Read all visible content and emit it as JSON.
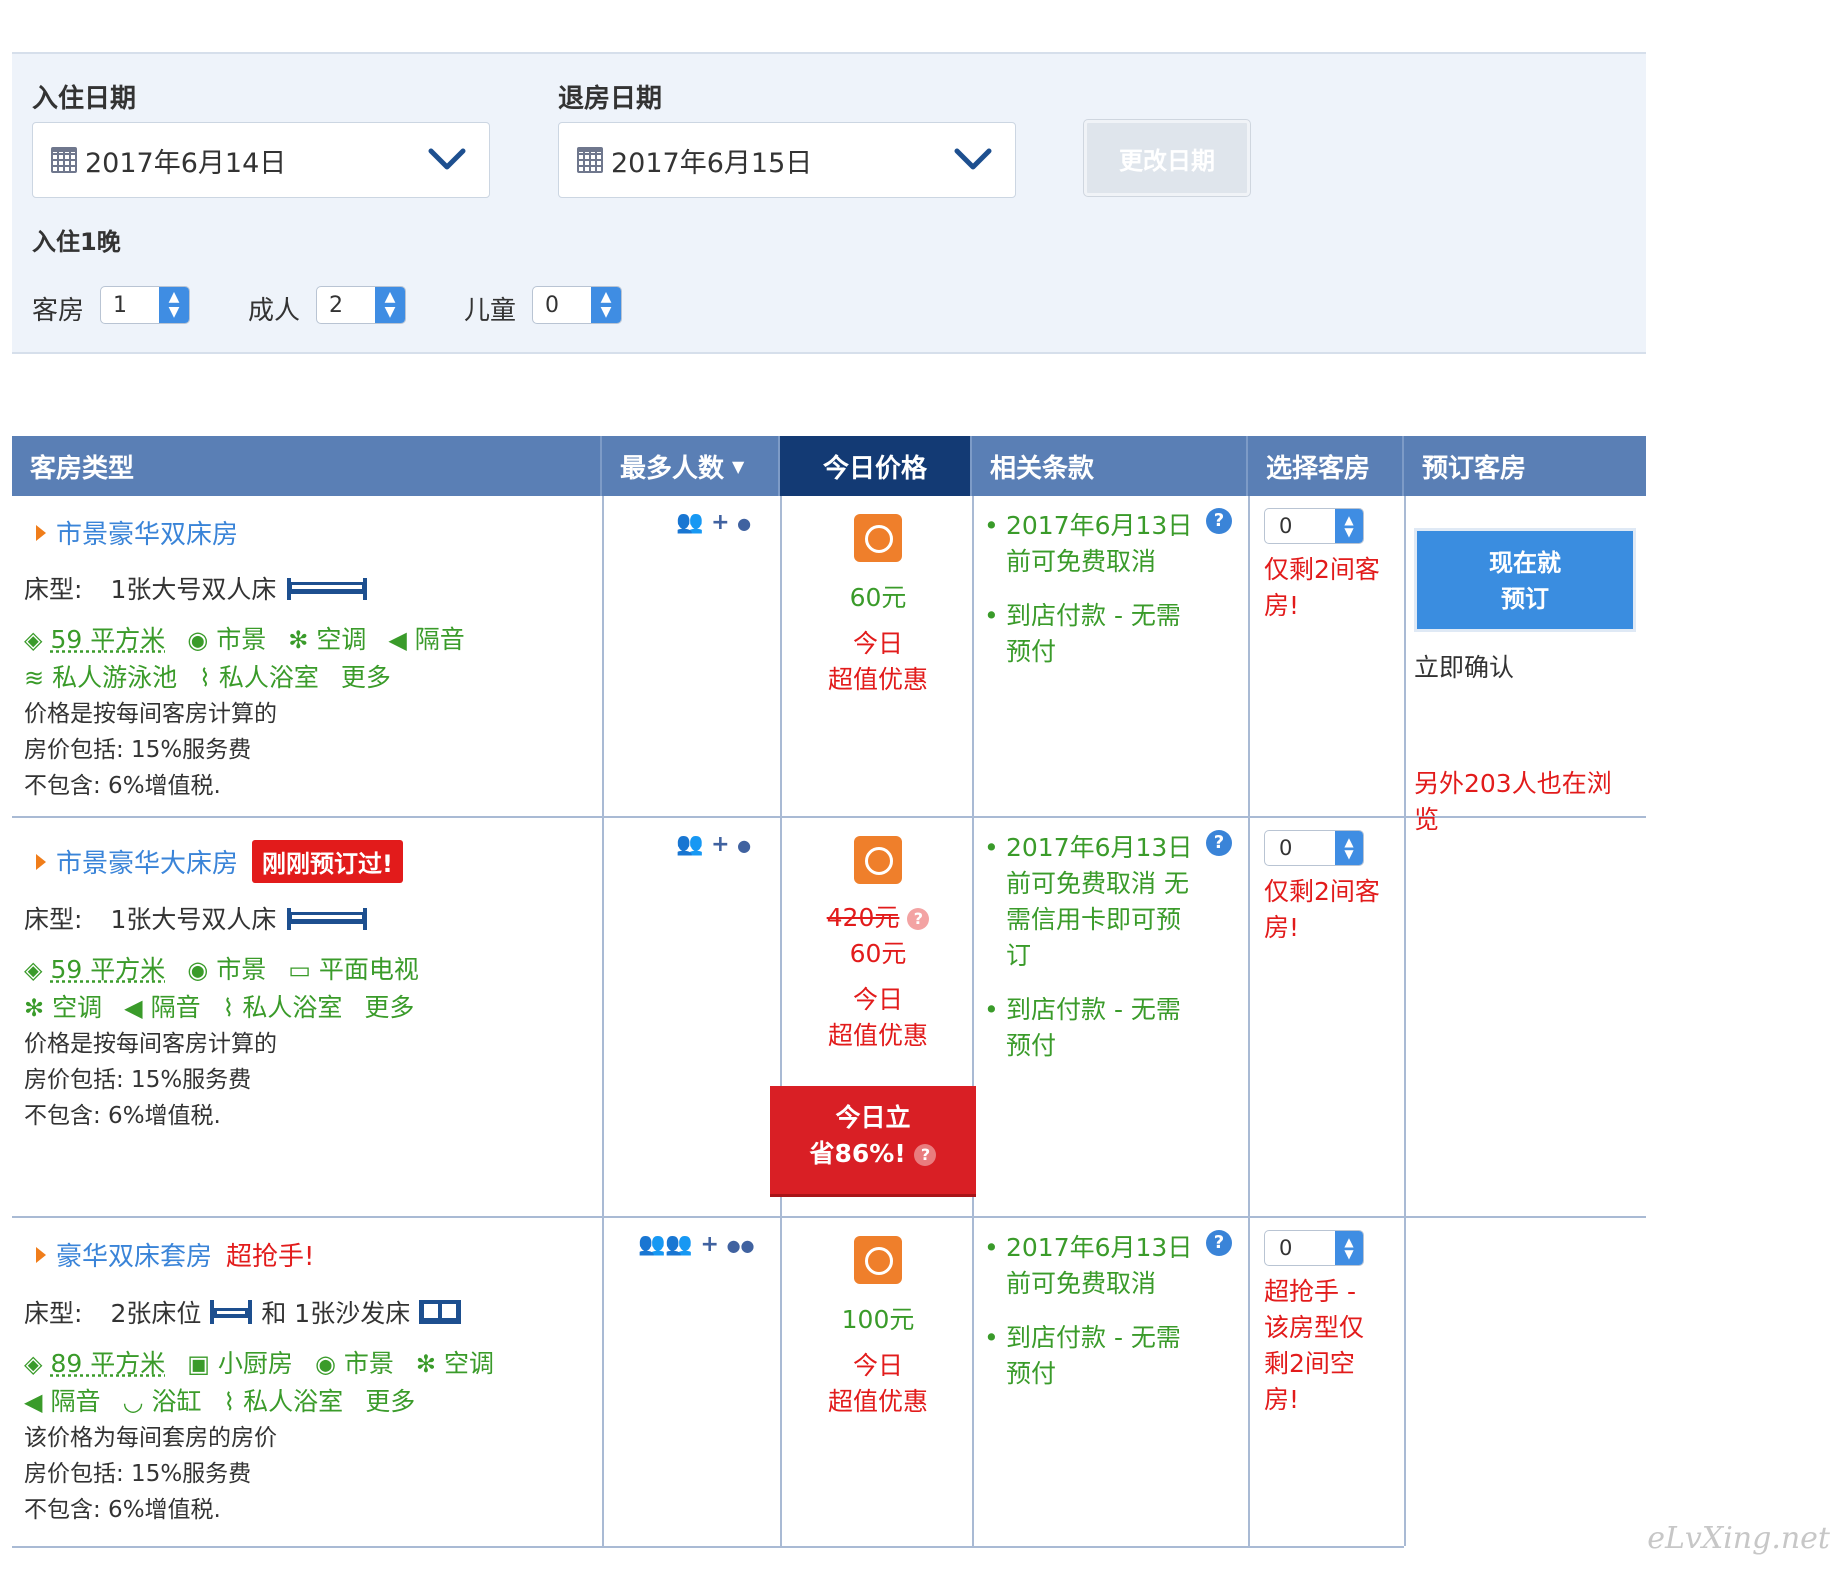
{
  "search": {
    "checkin_label": "入住日期",
    "checkin_value": "2017年6月14日",
    "checkout_label": "退房日期",
    "checkout_value": "2017年6月15日",
    "change_button": "更改日期",
    "nights": "入住1晚",
    "rooms_label": "客房",
    "rooms_value": "1",
    "adults_label": "成人",
    "adults_value": "2",
    "children_label": "儿童",
    "children_value": "0"
  },
  "table": {
    "headers": [
      "客房类型",
      "最多人数",
      "今日价格",
      "相关条款",
      "选择客房",
      "预订客房"
    ]
  },
  "rooms": [
    {
      "name": "市景豪华双床房",
      "bed_label": "床型:",
      "bed_value": "1张大号双人床",
      "features_line1": [
        "59 平方米",
        "市景",
        "空调",
        "隔音"
      ],
      "features_line2": [
        "私人游泳池",
        "私人浴室",
        "更多"
      ],
      "info": [
        "价格是按每间客房计算的",
        "房价包括: 15%服务费",
        "不包含: 6%增值税."
      ],
      "price": "60元",
      "deal_line1": "今日",
      "deal_line2": "超值优惠",
      "terms": [
        "2017年6月13日前可免费取消",
        "到店付款 - 无需预付"
      ],
      "select_value": "0",
      "left_text": "仅剩2间客房!"
    },
    {
      "name": "市景豪华大床房",
      "badge": "刚刚预订过!",
      "bed_label": "床型:",
      "bed_value": "1张大号双人床",
      "features_line1": [
        "59 平方米",
        "市景",
        "平面电视"
      ],
      "features_line2": [
        "空调",
        "隔音",
        "私人浴室",
        "更多"
      ],
      "info": [
        "价格是按每间客房计算的",
        "房价包括: 15%服务费",
        "不包含: 6%增值税."
      ],
      "old_price": "420元",
      "price": "60元",
      "deal_line1": "今日",
      "deal_line2": "超值优惠",
      "save_line1": "今日立",
      "save_line2": "省86%!",
      "terms": [
        "2017年6月13日前可免费取消 无需信用卡即可预订",
        "到店付款 - 无需预付"
      ],
      "select_value": "0",
      "left_text": "仅剩2间客房!"
    },
    {
      "name": "豪华双床套房",
      "hot": "超抢手!",
      "bed_label": "床型:",
      "bed_value": "2张床位",
      "bed_and": "和 1张沙发床",
      "features_line1": [
        "89 平方米",
        "小厨房",
        "市景",
        "空调"
      ],
      "features_line2": [
        "隔音",
        "浴缸",
        "私人浴室",
        "更多"
      ],
      "info": [
        "该价格为每间套房的房价",
        "房价包括: 15%服务费",
        "不包含: 6%增值税."
      ],
      "price": "100元",
      "deal_line1": "今日",
      "deal_line2": "超值优惠",
      "terms": [
        "2017年6月13日前可免费取消",
        "到店付款 - 无需预付"
      ],
      "select_value": "0",
      "left_text": "超抢手 - 该房型仅剩2间空房!"
    }
  ],
  "booking": {
    "button_line1": "现在就",
    "button_line2": "预订",
    "confirm": "立即确认",
    "viewers": "另外203人也在浏览"
  },
  "watermark": "eLvXing.net",
  "colors": {
    "header_bg": "#5a7fb5",
    "header_active": "#133a74",
    "green": "#3a9b2a",
    "red": "#e21b1b",
    "blue": "#3a84d8"
  }
}
